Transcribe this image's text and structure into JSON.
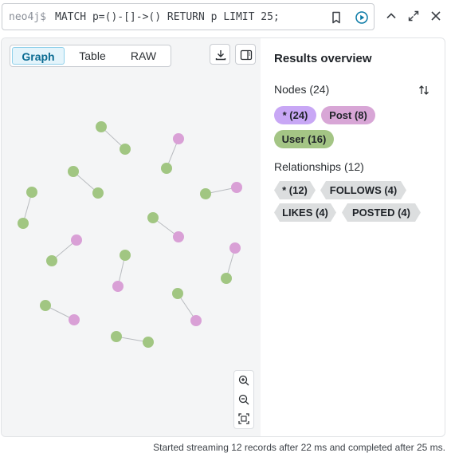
{
  "editor": {
    "prompt": "neo4j$",
    "query": "MATCH p=()-[]->() RETURN p LIMIT 25;"
  },
  "view_tabs": [
    {
      "label": "Graph",
      "active": true
    },
    {
      "label": "Table",
      "active": false
    },
    {
      "label": "RAW",
      "active": false
    }
  ],
  "overview": {
    "title": "Results overview",
    "nodes_heading": "Nodes (24)",
    "node_labels": [
      {
        "label": "* (24)",
        "color": "#c8a7f5"
      },
      {
        "label": "Post (8)",
        "color": "#d8a6d6"
      },
      {
        "label": "User (16)",
        "color": "#a4c585"
      }
    ],
    "relationships_heading": "Relationships (12)",
    "rel_types": [
      "* (12)",
      "FOLLOWS (4)",
      "LIKES (4)",
      "POSTED (4)"
    ]
  },
  "graph": {
    "colors": {
      "user": "#a1c682",
      "post": "#d9a0d6",
      "edge": "#b9bcc0"
    },
    "user_count": 16,
    "post_count": 8,
    "relationship_count": 12
  },
  "status": "Started streaming 12 records after 22 ms and completed after 25 ms.",
  "icons": [
    "bookmark-icon",
    "run-icon",
    "chevron-up-icon",
    "expand-icon",
    "close-icon",
    "download-icon",
    "sidebar-toggle-icon",
    "sort-icon",
    "zoom-in-icon",
    "zoom-out-icon",
    "fit-icon"
  ]
}
